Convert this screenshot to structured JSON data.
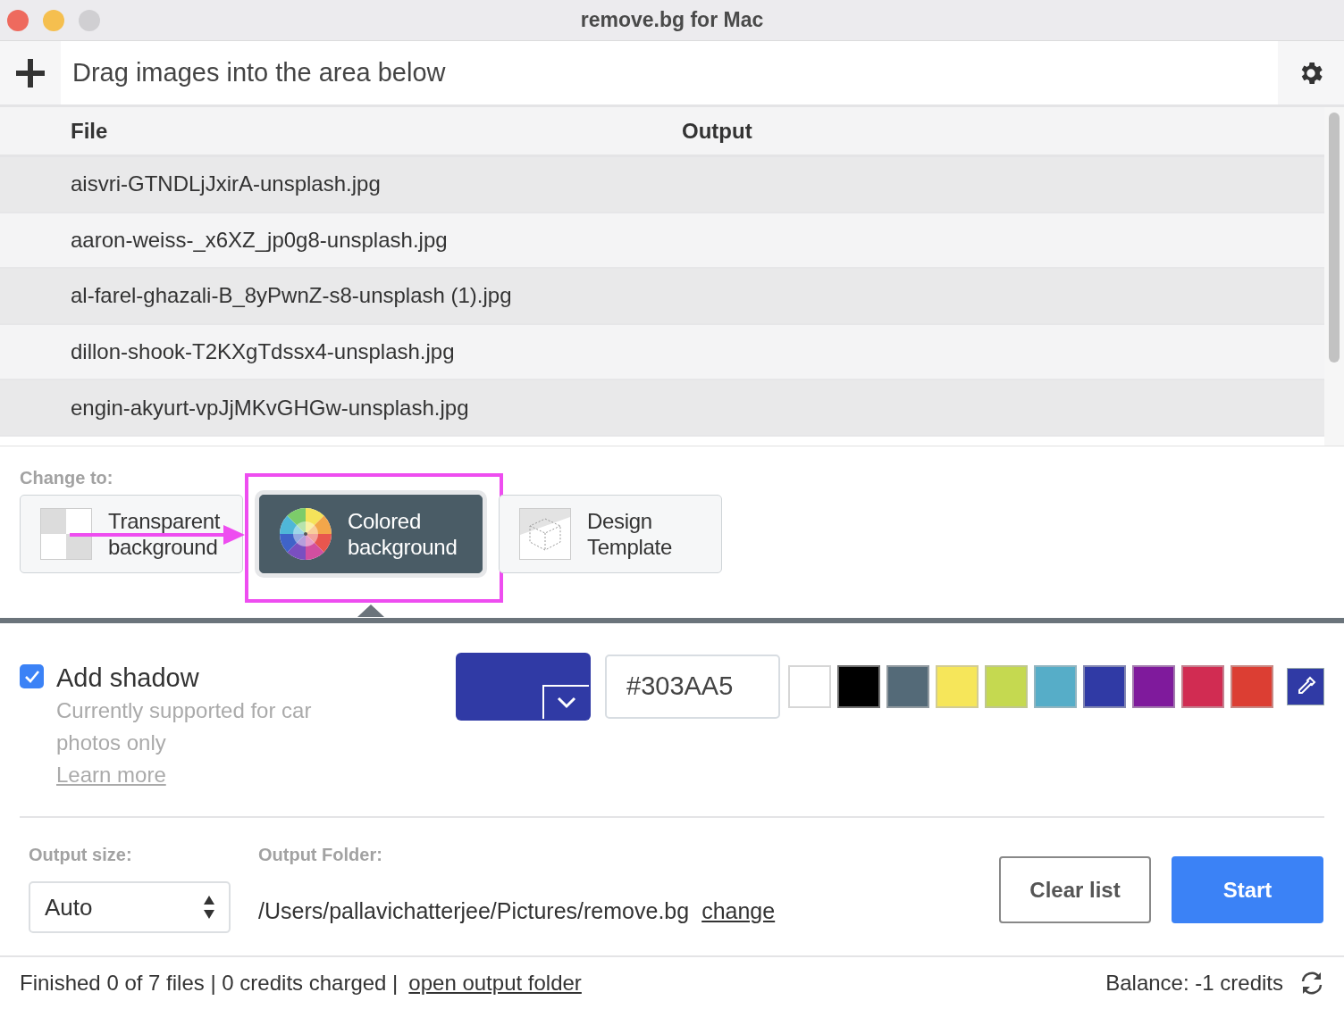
{
  "window": {
    "title": "remove.bg for Mac"
  },
  "toolbar": {
    "message": "Drag images into the area below"
  },
  "table": {
    "columns": [
      "File",
      "Output"
    ],
    "rows": [
      {
        "file": "aisvri-GTNDLjJxirA-unsplash.jpg"
      },
      {
        "file": "aaron-weiss-_x6XZ_jp0g8-unsplash.jpg"
      },
      {
        "file": "al-farel-ghazali-B_8yPwnZ-s8-unsplash (1).jpg"
      },
      {
        "file": "dillon-shook-T2KXgTdssx4-unsplash.jpg"
      },
      {
        "file": "engin-akyurt-vpJjMKvGHGw-unsplash.jpg"
      }
    ]
  },
  "change_to": {
    "label": "Change to:",
    "options": [
      {
        "kind": "transparent",
        "label": "Transparent background",
        "selected": false
      },
      {
        "kind": "colored",
        "label": "Colored background",
        "selected": true
      },
      {
        "kind": "template",
        "label": "Design Template",
        "selected": false
      }
    ]
  },
  "shadow": {
    "label": "Add shadow",
    "checked": true,
    "note": "Currently supported for car photos only",
    "link": "Learn more"
  },
  "color": {
    "hex": "#303AA5",
    "swatches": [
      {
        "color": "#ffffff"
      },
      {
        "color": "#000000"
      },
      {
        "color": "#546a78"
      },
      {
        "color": "#f6e65a"
      },
      {
        "color": "#c5d950"
      },
      {
        "color": "#56adc8"
      },
      {
        "color": "#303aa5"
      },
      {
        "color": "#7f1a9c"
      },
      {
        "color": "#d12c52"
      },
      {
        "color": "#dc3e33"
      }
    ]
  },
  "output": {
    "size_label": "Output size:",
    "size": "Auto",
    "folder_label": "Output Folder:",
    "folder": "/Users/pallavichatterjee/Pictures/remove.bg",
    "change": "change"
  },
  "buttons": [
    {
      "kind": "secondary",
      "label": "Clear list"
    },
    {
      "kind": "primary",
      "label": "Start"
    }
  ],
  "status": {
    "text": "Finished 0 of 7 files | 0 credits charged |",
    "link": "open output folder",
    "balance": "Balance: -1 credits"
  }
}
